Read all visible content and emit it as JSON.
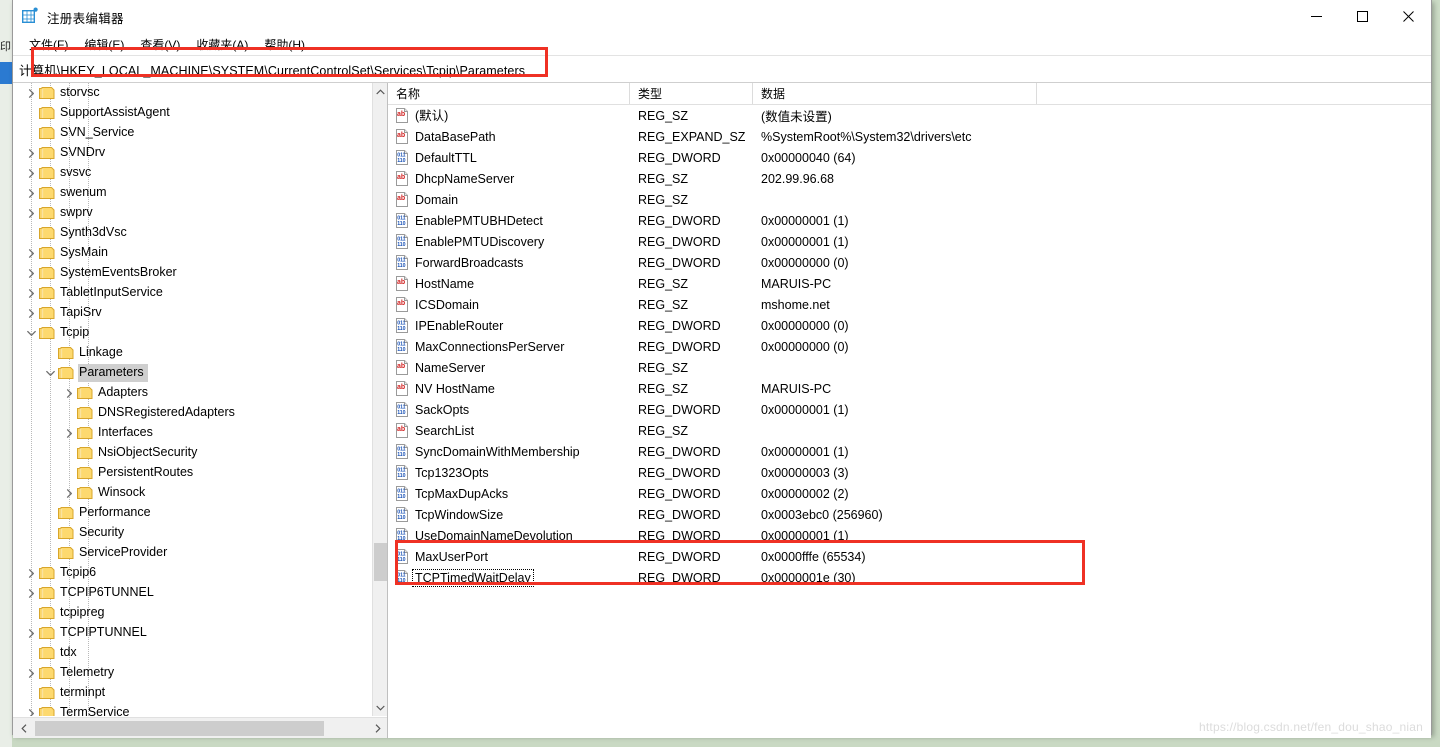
{
  "desktop": {
    "left_fragment_text": "印"
  },
  "window": {
    "title": "注册表编辑器",
    "icon": "registry-editor-icon",
    "controls": {
      "minimize": "—",
      "maximize": "□",
      "close": "✕"
    }
  },
  "menu": {
    "items": [
      {
        "label": "文件(F)",
        "name": "menu-file"
      },
      {
        "label": "编辑(E)",
        "name": "menu-edit"
      },
      {
        "label": "查看(V)",
        "name": "menu-view"
      },
      {
        "label": "收藏夹(A)",
        "name": "menu-favorites"
      },
      {
        "label": "帮助(H)",
        "name": "menu-help"
      }
    ]
  },
  "address": {
    "path": "计算机\\HKEY_LOCAL_MACHINE\\SYSTEM\\CurrentControlSet\\Services\\Tcpip\\Parameters"
  },
  "tree": {
    "items": [
      {
        "label": "storvsc",
        "indent": 4,
        "twisty": "collapsed",
        "selected": false
      },
      {
        "label": "SupportAssistAgent",
        "indent": 4,
        "twisty": "none",
        "selected": false
      },
      {
        "label": "SVN_Service",
        "indent": 4,
        "twisty": "none",
        "selected": false
      },
      {
        "label": "SVNDrv",
        "indent": 4,
        "twisty": "collapsed",
        "selected": false
      },
      {
        "label": "svsvc",
        "indent": 4,
        "twisty": "collapsed",
        "selected": false
      },
      {
        "label": "swenum",
        "indent": 4,
        "twisty": "collapsed",
        "selected": false
      },
      {
        "label": "swprv",
        "indent": 4,
        "twisty": "collapsed",
        "selected": false
      },
      {
        "label": "Synth3dVsc",
        "indent": 4,
        "twisty": "none",
        "selected": false
      },
      {
        "label": "SysMain",
        "indent": 4,
        "twisty": "collapsed",
        "selected": false
      },
      {
        "label": "SystemEventsBroker",
        "indent": 4,
        "twisty": "collapsed",
        "selected": false
      },
      {
        "label": "TabletInputService",
        "indent": 4,
        "twisty": "collapsed",
        "selected": false
      },
      {
        "label": "TapiSrv",
        "indent": 4,
        "twisty": "collapsed",
        "selected": false
      },
      {
        "label": "Tcpip",
        "indent": 4,
        "twisty": "expanded",
        "selected": false
      },
      {
        "label": "Linkage",
        "indent": 5,
        "twisty": "none",
        "selected": false
      },
      {
        "label": "Parameters",
        "indent": 5,
        "twisty": "expanded",
        "selected": true
      },
      {
        "label": "Adapters",
        "indent": 6,
        "twisty": "collapsed",
        "selected": false
      },
      {
        "label": "DNSRegisteredAdapters",
        "indent": 6,
        "twisty": "none",
        "selected": false
      },
      {
        "label": "Interfaces",
        "indent": 6,
        "twisty": "collapsed",
        "selected": false
      },
      {
        "label": "NsiObjectSecurity",
        "indent": 6,
        "twisty": "none",
        "selected": false
      },
      {
        "label": "PersistentRoutes",
        "indent": 6,
        "twisty": "none",
        "selected": false
      },
      {
        "label": "Winsock",
        "indent": 6,
        "twisty": "collapsed",
        "selected": false
      },
      {
        "label": "Performance",
        "indent": 5,
        "twisty": "none",
        "selected": false
      },
      {
        "label": "Security",
        "indent": 5,
        "twisty": "none",
        "selected": false
      },
      {
        "label": "ServiceProvider",
        "indent": 5,
        "twisty": "none",
        "selected": false
      },
      {
        "label": "Tcpip6",
        "indent": 4,
        "twisty": "collapsed",
        "selected": false
      },
      {
        "label": "TCPIP6TUNNEL",
        "indent": 4,
        "twisty": "collapsed",
        "selected": false
      },
      {
        "label": "tcpipreg",
        "indent": 4,
        "twisty": "none",
        "selected": false
      },
      {
        "label": "TCPIPTUNNEL",
        "indent": 4,
        "twisty": "collapsed",
        "selected": false
      },
      {
        "label": "tdx",
        "indent": 4,
        "twisty": "none",
        "selected": false
      },
      {
        "label": "Telemetry",
        "indent": 4,
        "twisty": "collapsed",
        "selected": false
      },
      {
        "label": "terminpt",
        "indent": 4,
        "twisty": "none",
        "selected": false
      },
      {
        "label": "TermService",
        "indent": 4,
        "twisty": "collapsed",
        "selected": false
      }
    ]
  },
  "list": {
    "columns": {
      "name": "名称",
      "type": "类型",
      "data": "数据"
    },
    "rows": [
      {
        "icon": "string-value-icon",
        "name": "(默认)",
        "type": "REG_SZ",
        "data": "(数值未设置)",
        "focused": false
      },
      {
        "icon": "string-value-icon",
        "name": "DataBasePath",
        "type": "REG_EXPAND_SZ",
        "data": "%SystemRoot%\\System32\\drivers\\etc",
        "focused": false
      },
      {
        "icon": "dword-value-icon",
        "name": "DefaultTTL",
        "type": "REG_DWORD",
        "data": "0x00000040 (64)",
        "focused": false
      },
      {
        "icon": "string-value-icon",
        "name": "DhcpNameServer",
        "type": "REG_SZ",
        "data": "202.99.96.68",
        "focused": false
      },
      {
        "icon": "string-value-icon",
        "name": "Domain",
        "type": "REG_SZ",
        "data": "",
        "focused": false
      },
      {
        "icon": "dword-value-icon",
        "name": "EnablePMTUBHDetect",
        "type": "REG_DWORD",
        "data": "0x00000001 (1)",
        "focused": false
      },
      {
        "icon": "dword-value-icon",
        "name": "EnablePMTUDiscovery",
        "type": "REG_DWORD",
        "data": "0x00000001 (1)",
        "focused": false
      },
      {
        "icon": "dword-value-icon",
        "name": "ForwardBroadcasts",
        "type": "REG_DWORD",
        "data": "0x00000000 (0)",
        "focused": false
      },
      {
        "icon": "string-value-icon",
        "name": "HostName",
        "type": "REG_SZ",
        "data": "MARUIS-PC",
        "focused": false
      },
      {
        "icon": "string-value-icon",
        "name": "ICSDomain",
        "type": "REG_SZ",
        "data": "mshome.net",
        "focused": false
      },
      {
        "icon": "dword-value-icon",
        "name": "IPEnableRouter",
        "type": "REG_DWORD",
        "data": "0x00000000 (0)",
        "focused": false
      },
      {
        "icon": "dword-value-icon",
        "name": "MaxConnectionsPerServer",
        "type": "REG_DWORD",
        "data": "0x00000000 (0)",
        "focused": false
      },
      {
        "icon": "string-value-icon",
        "name": "NameServer",
        "type": "REG_SZ",
        "data": "",
        "focused": false
      },
      {
        "icon": "string-value-icon",
        "name": "NV HostName",
        "type": "REG_SZ",
        "data": "MARUIS-PC",
        "focused": false
      },
      {
        "icon": "dword-value-icon",
        "name": "SackOpts",
        "type": "REG_DWORD",
        "data": "0x00000001 (1)",
        "focused": false
      },
      {
        "icon": "string-value-icon",
        "name": "SearchList",
        "type": "REG_SZ",
        "data": "",
        "focused": false
      },
      {
        "icon": "dword-value-icon",
        "name": "SyncDomainWithMembership",
        "type": "REG_DWORD",
        "data": "0x00000001 (1)",
        "focused": false
      },
      {
        "icon": "dword-value-icon",
        "name": "Tcp1323Opts",
        "type": "REG_DWORD",
        "data": "0x00000003 (3)",
        "focused": false
      },
      {
        "icon": "dword-value-icon",
        "name": "TcpMaxDupAcks",
        "type": "REG_DWORD",
        "data": "0x00000002 (2)",
        "focused": false
      },
      {
        "icon": "dword-value-icon",
        "name": "TcpWindowSize",
        "type": "REG_DWORD",
        "data": "0x0003ebc0 (256960)",
        "focused": false
      },
      {
        "icon": "dword-value-icon",
        "name": "UseDomainNameDevolution",
        "type": "REG_DWORD",
        "data": "0x00000001 (1)",
        "focused": false
      },
      {
        "icon": "dword-value-icon",
        "name": "MaxUserPort",
        "type": "REG_DWORD",
        "data": "0x0000fffe (65534)",
        "focused": false
      },
      {
        "icon": "dword-value-icon",
        "name": "TCPTimedWaitDelay",
        "type": "REG_DWORD",
        "data": "0x0000001e (30)",
        "focused": true
      }
    ]
  },
  "annotations": {
    "accent_color": "#ef3124",
    "address_box": "highlight-address-path",
    "rows_box": "highlight-new-values"
  },
  "watermark": {
    "text": "https://blog.csdn.net/fen_dou_shao_nian"
  }
}
